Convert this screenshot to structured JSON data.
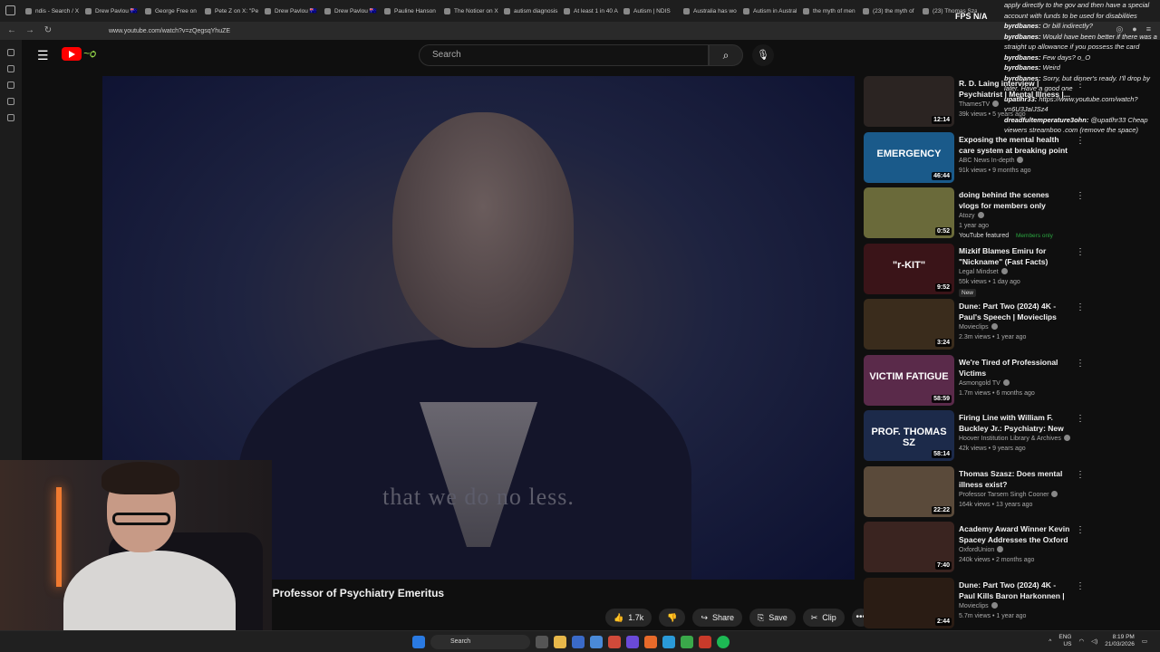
{
  "browser": {
    "tabs": [
      "ndis - Search / X",
      "Drew Pavlou 🇦🇺",
      "George Free on",
      "Pete Z on X: \"Pe",
      "Drew Pavlou 🇦🇺",
      "Drew Pavlou 🇦🇺",
      "Pauline Hanson",
      "The Noticer on X",
      "autism diagnosis",
      "At least 1 in 40 A",
      "Autism | NDIS",
      "Australia has wo",
      "Autism in Austral",
      "the myth of men",
      "(23) the myth of",
      "(23) Thomas Szas"
    ],
    "url": "www.youtube.com/watch?v=zQegsqYhuZE",
    "fps": "FPS",
    "fps_value": "N/A"
  },
  "youtube": {
    "search_placeholder": "Search",
    "video_subtitle": "that we do no less.",
    "video_title": "r, Professor of Psychiatry Emeritus",
    "likes": "1.7k",
    "share_label": "Share",
    "save_label": "Save",
    "clip_label": "Clip"
  },
  "related": [
    {
      "title": "R. D. Laing interview | Psychiatrist | Mental Illness |...",
      "channel": "ThamesTV",
      "meta": "39k views • 5 years ago",
      "duration": "12:14",
      "thumb_color": "#2b2422",
      "thumb_text": ""
    },
    {
      "title": "Exposing the mental health care system at breaking point | Four...",
      "channel": "ABC News In-depth",
      "meta": "91k views • 9 months ago",
      "duration": "46:44",
      "thumb_color": "#1a5a8a",
      "thumb_text": "EMERGENCY"
    },
    {
      "title": "doing behind the scenes vlogs for members only",
      "channel": "Atozy",
      "meta": "1 year ago",
      "duration": "0:52",
      "thumb_color": "#6a6a3a",
      "thumb_text": "",
      "featured": "YouTube featured",
      "members": "Members only"
    },
    {
      "title": "Mizkif Blames Emiru for \"Nickname\" (Fast Facts)",
      "channel": "Legal Mindset",
      "meta": "55k views • 1 day ago",
      "duration": "9:52",
      "thumb_color": "#3a1418",
      "thumb_text": "\"r-KIT\"",
      "badge": "New"
    },
    {
      "title": "Dune: Part Two (2024) 4K - Paul's Speech | Movieclips",
      "channel": "Movieclips",
      "meta": "2.3m views • 1 year ago",
      "duration": "3:24",
      "thumb_color": "#3a2c1c",
      "thumb_text": ""
    },
    {
      "title": "We're Tired of Professional Victims",
      "channel": "Asmongold TV",
      "meta": "1.7m views • 6 months ago",
      "duration": "58:59",
      "thumb_color": "#5a2a4a",
      "thumb_text": "VICTIM FATIGUE"
    },
    {
      "title": "Firing Line with William F. Buckley Jr.: Psychiatry: New ...",
      "channel": "Hoover Institution Library & Archives",
      "meta": "42k views • 9 years ago",
      "duration": "58:14",
      "thumb_color": "#1c2a4a",
      "thumb_text": "PROF. THOMAS SZ"
    },
    {
      "title": "Thomas Szasz: Does mental illness exist?",
      "channel": "Professor Tarsem Singh Cooner",
      "meta": "164k views • 13 years ago",
      "duration": "22:22",
      "thumb_color": "#5a4a3a",
      "thumb_text": ""
    },
    {
      "title": "Academy Award Winner Kevin Spacey Addresses the Oxford ...",
      "channel": "OxfordUnion",
      "meta": "240k views • 2 months ago",
      "duration": "7:40",
      "thumb_color": "#3a2420",
      "thumb_text": ""
    },
    {
      "title": "Dune: Part Two (2024) 4K - Paul Kills Baron Harkonnen | ...",
      "channel": "Movieclips",
      "meta": "5.7m views • 1 year ago",
      "duration": "2:44",
      "thumb_color": "#2a1c14",
      "thumb_text": ""
    }
  ],
  "chat": [
    {
      "user": "",
      "text": "apply directly to the gov and then have a special account with funds to be used for disabilities"
    },
    {
      "user": "byrdbanes",
      "text": "Or bill indirectly?"
    },
    {
      "user": "byrdbanes",
      "text": "Would have been better if there was a straight up allowance if you possess the card"
    },
    {
      "user": "byrdbanes",
      "text": "Few days? o_O"
    },
    {
      "user": "byrdbanes",
      "text": "Weird"
    },
    {
      "user": "byrdbanes",
      "text": "Sorry, but dinner's ready. I'll drop by later. Have a good one"
    },
    {
      "user": "upatlhr33",
      "text": "https://www.youtube.com/watch?v=6U3JaIJSz4"
    },
    {
      "user": "dreadfultemperature3ohn",
      "text": "@upatlhr33 Cheap viewers streamboo .com (remove the space)"
    }
  ],
  "taskbar": {
    "search_label": "Search",
    "lang": "ENG",
    "region": "US",
    "time": "8:19 PM",
    "date": "21/03/2026"
  }
}
